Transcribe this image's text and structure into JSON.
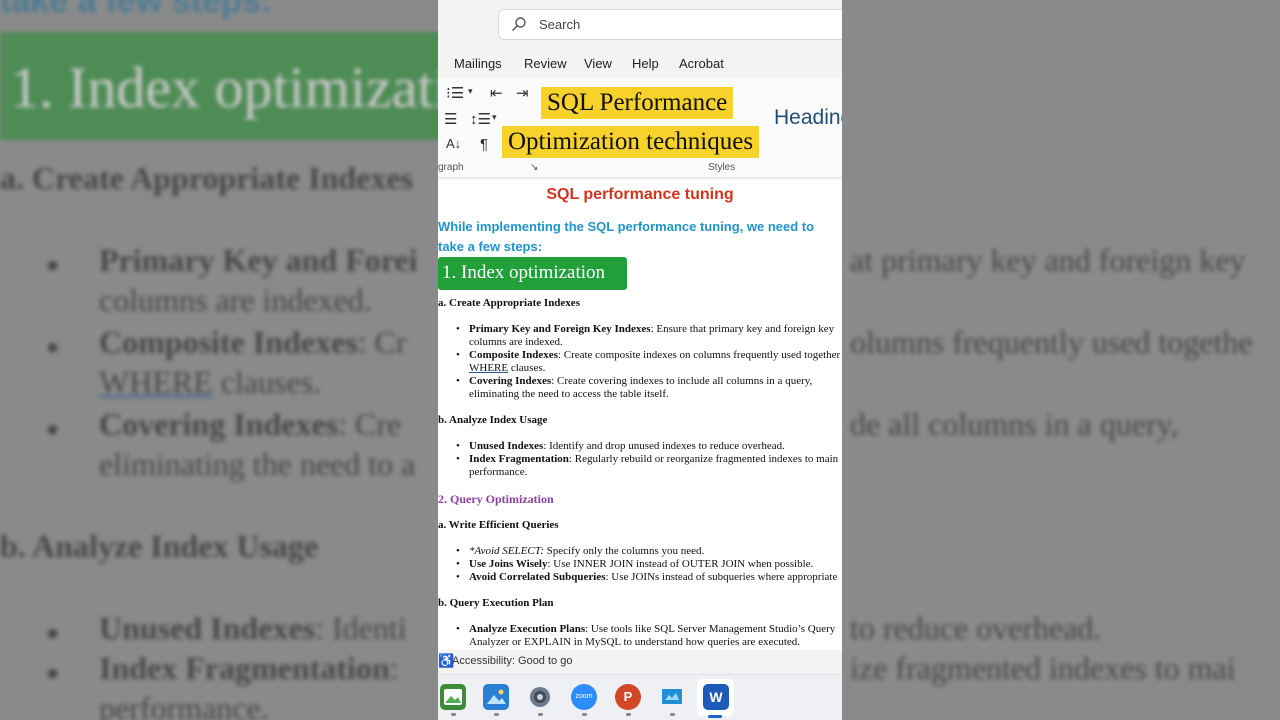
{
  "background": {
    "top_text": "take a few steps:",
    "heading": "1. Index optimization",
    "sub_a": "a. Create Appropriate Indexes",
    "b1_bold": "Primary Key and Forei",
    "b1_cont": "columns are indexed.",
    "b2_bold": "Composite Indexes",
    "b2_rest": ": Cr",
    "b2_cont": "WHERE",
    "b2_cont2": " clauses.",
    "b3_bold": "Covering Indexes",
    "b3_rest": ": Cre",
    "b3_cont": "eliminating the need to a",
    "sub_b": "b. Analyze Index Usage",
    "b4_bold": "Unused Indexes",
    "b4_rest": ": Identi",
    "b5_bold": "Index Fragmentation",
    "b5_rest": ":",
    "b5_cont": "performance.",
    "r1": "at primary key and foreign key",
    "r2": "olumns frequently used togethe",
    "r3": "de all columns in a query,",
    "r4": "to reduce overhead.",
    "r5": "ize fragmented indexes to mai"
  },
  "search": {
    "placeholder": "Search"
  },
  "menu": {
    "items": [
      "Mailings",
      "Review",
      "View",
      "Help",
      "Acrobat"
    ]
  },
  "ribbon": {
    "group_paragraph": "graph",
    "group_styles": "Styles",
    "style_heading": "Heading",
    "pilcrow": "¶"
  },
  "overlay": {
    "line1": "SQL Performance",
    "line2": "Optimization techniques"
  },
  "doc": {
    "title": "SQL performance tuning",
    "intro1": "While implementing the SQL performance tuning, we need to",
    "intro2": "take a few steps:",
    "h1": "1. Index optimization",
    "sec_a": "a. Create Appropriate Indexes",
    "items_a": [
      {
        "bold": "Primary Key and Foreign Key Indexes",
        "rest": ": Ensure that primary key and foreign key",
        "cont": "columns are indexed."
      },
      {
        "bold": "Composite Indexes",
        "rest": ": Create composite indexes on columns frequently used together",
        "cont_u": "WHERE",
        "cont": " clauses."
      },
      {
        "bold": "Covering Indexes",
        "rest": ": Create covering indexes to include all columns in a query,",
        "cont": "eliminating the need to access the table itself."
      }
    ],
    "sec_b": "b. Analyze Index Usage",
    "items_b": [
      {
        "bold": "Unused Indexes",
        "rest": ": Identify and drop unused indexes to reduce overhead."
      },
      {
        "bold": "Index Fragmentation",
        "rest": ": Regularly rebuild or reorganize fragmented indexes to main",
        "cont": "performance."
      }
    ],
    "h2": "2. Query Optimization",
    "sec_c": "a. Write Efficient Queries",
    "items_c": [
      {
        "italic": "*Avoid SELECT:",
        "rest": " Specify only the columns you need."
      },
      {
        "bold": "Use Joins Wisely",
        "rest": ": Use INNER JOIN instead of OUTER JOIN when possible."
      },
      {
        "bold": "Avoid Correlated Subqueries",
        "rest": ": Use JOINs instead of subqueries where appropriate"
      }
    ],
    "sec_d": "b. Query Execution Plan",
    "items_d": [
      {
        "bold": "Analyze Execution Plans",
        "rest": ": Use tools like SQL Server Management Studio’s Query",
        "cont": "Analyzer or EXPLAIN in MySQL to understand how queries are executed."
      }
    ]
  },
  "status": {
    "accessibility": "Accessibility: Good to go"
  },
  "taskbar": {
    "apps": [
      "photo-editor-icon",
      "photos-icon",
      "settings-icon",
      "zoom-icon",
      "powerpoint-icon",
      "whiteboard-icon",
      "word-icon"
    ],
    "zoom_label": "zoom",
    "word_label": "W",
    "ppt_label": "P"
  },
  "colors": {
    "doc_title": "#d2351e",
    "intro": "#2294c8",
    "green_heading": "#21a03a",
    "purple_heading": "#8b3fa0",
    "overlay_bg": "#f6d22b"
  }
}
